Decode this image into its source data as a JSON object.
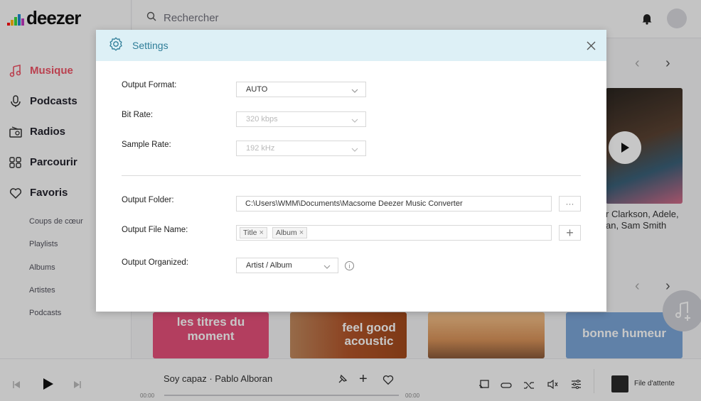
{
  "app": {
    "logo": "deezer"
  },
  "search": {
    "placeholder": "Rechercher"
  },
  "sidebar": {
    "items": [
      {
        "label": "Musique",
        "icon": "music-note-icon"
      },
      {
        "label": "Podcasts",
        "icon": "microphone-icon"
      },
      {
        "label": "Radios",
        "icon": "radio-icon"
      },
      {
        "label": "Parcourir",
        "icon": "grid-icon"
      },
      {
        "label": "Favoris",
        "icon": "heart-icon"
      }
    ],
    "sub_items": [
      "Coups de cœur",
      "Playlists",
      "Albums",
      "Artistes",
      "Podcasts"
    ]
  },
  "content": {
    "artists_line1": "r Clarkson, Adele,",
    "artists_line2": "an, Sam Smith",
    "cards": [
      "les titres du moment",
      "feel good acoustic",
      "",
      "bonne humeur"
    ]
  },
  "player": {
    "track": "Soy capaz · Pablo Alboran",
    "time_start": "00:00",
    "time_end": "00:00",
    "queue_label": "File d'attente"
  },
  "settings": {
    "title": "Settings",
    "output_format": {
      "label": "Output Format:",
      "value": "AUTO"
    },
    "bit_rate": {
      "label": "Bit Rate:",
      "value": "320 kbps"
    },
    "sample_rate": {
      "label": "Sample Rate:",
      "value": "192 kHz"
    },
    "output_folder": {
      "label": "Output Folder:",
      "value": "C:\\Users\\WMM\\Documents\\Macsome Deezer Music Converter",
      "browse": "···"
    },
    "output_file_name": {
      "label": "Output File Name:",
      "tags": [
        "Title",
        "Album"
      ],
      "add": "+"
    },
    "output_organized": {
      "label": "Output Organized:",
      "value": "Artist / Album",
      "info": "i"
    }
  },
  "colors": {
    "accent": "#ef5466",
    "dialog_header": "#ddf0f6",
    "dialog_title": "#2e7d98"
  }
}
